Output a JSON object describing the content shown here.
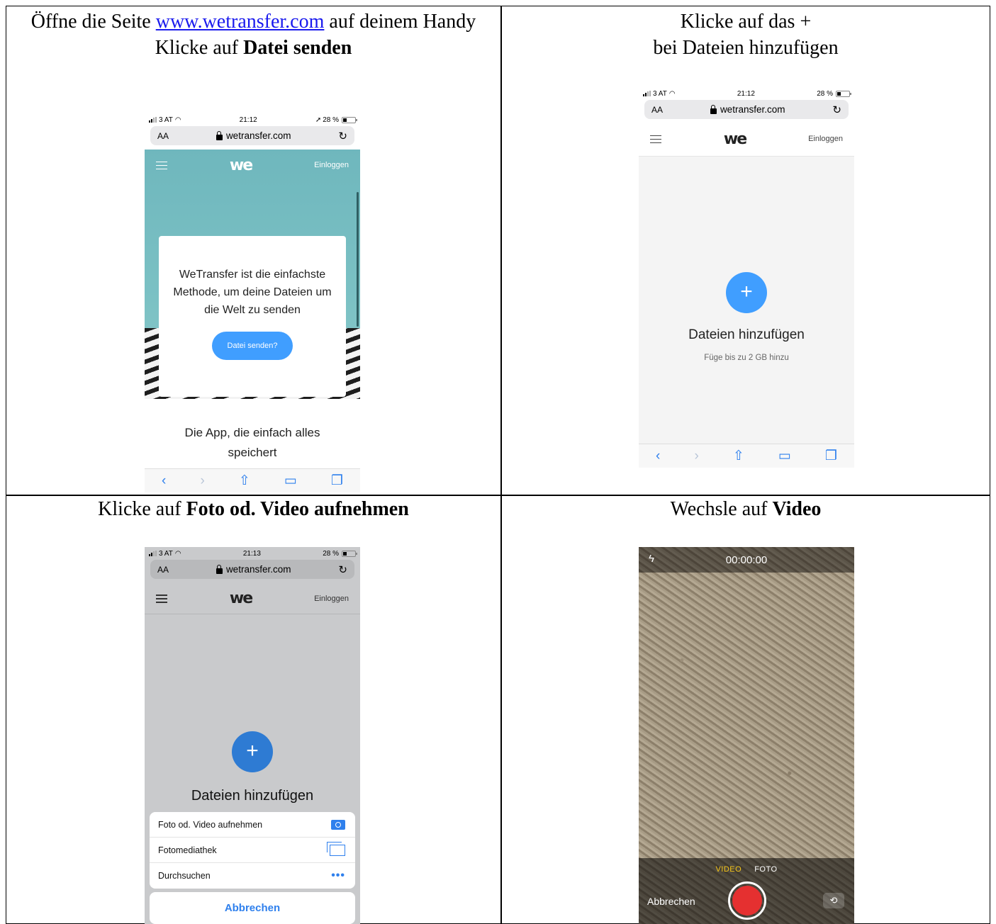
{
  "captions": {
    "c1": {
      "pre": "Öffne die Seite ",
      "link": "www.wetransfer.com",
      "post": " auf deinem Handy",
      "line2_pre": "Klicke auf ",
      "line2_bold": "Datei senden"
    },
    "c2": {
      "line1": "Klicke auf das +",
      "line2": "bei Dateien hinzufügen"
    },
    "c3": {
      "pre": "Klicke auf ",
      "bold": "Foto od. Video aufnehmen"
    },
    "c4": {
      "pre": "Wechsle auf ",
      "bold": "Video"
    }
  },
  "status": {
    "carrier": "3 AT",
    "time1": "21:12",
    "time3": "21:13",
    "battery1": "28 %",
    "battery": "28 %",
    "location_arrow": "➚"
  },
  "browser": {
    "aa": "AA",
    "url": "wetransfer.com",
    "reload": "↻"
  },
  "site": {
    "logo": "we",
    "login": "Einloggen"
  },
  "panel1": {
    "card_text": "WeTransfer ist die einfachste Methode, um deine Dateien um die Welt zu senden",
    "button": "Datei senden?",
    "app_text": "Die App, die einfach alles speichert"
  },
  "panel2": {
    "plus": "+",
    "title": "Dateien hinzufügen",
    "subtitle": "Füge bis zu 2 GB hinzu"
  },
  "panel3": {
    "plus": "+",
    "title": "Dateien hinzufügen",
    "options": [
      "Foto od. Video aufnehmen",
      "Fotomediathek",
      "Durchsuchen"
    ],
    "cancel": "Abbrechen"
  },
  "panel4": {
    "timer": "00:00:00",
    "mode_video": "VIDEO",
    "mode_foto": "FOTO",
    "cancel": "Abbrechen"
  },
  "toolbar": {
    "back": "‹",
    "forward": "›"
  },
  "icons": [
    "wifi-icon",
    "lock-icon",
    "reload-icon",
    "menu-icon",
    "back-icon",
    "forward-icon",
    "share-icon",
    "bookmarks-icon",
    "tabs-icon",
    "camera-icon",
    "gallery-icon",
    "more-icon",
    "flash-icon",
    "shutter-icon",
    "flip-camera-icon"
  ]
}
